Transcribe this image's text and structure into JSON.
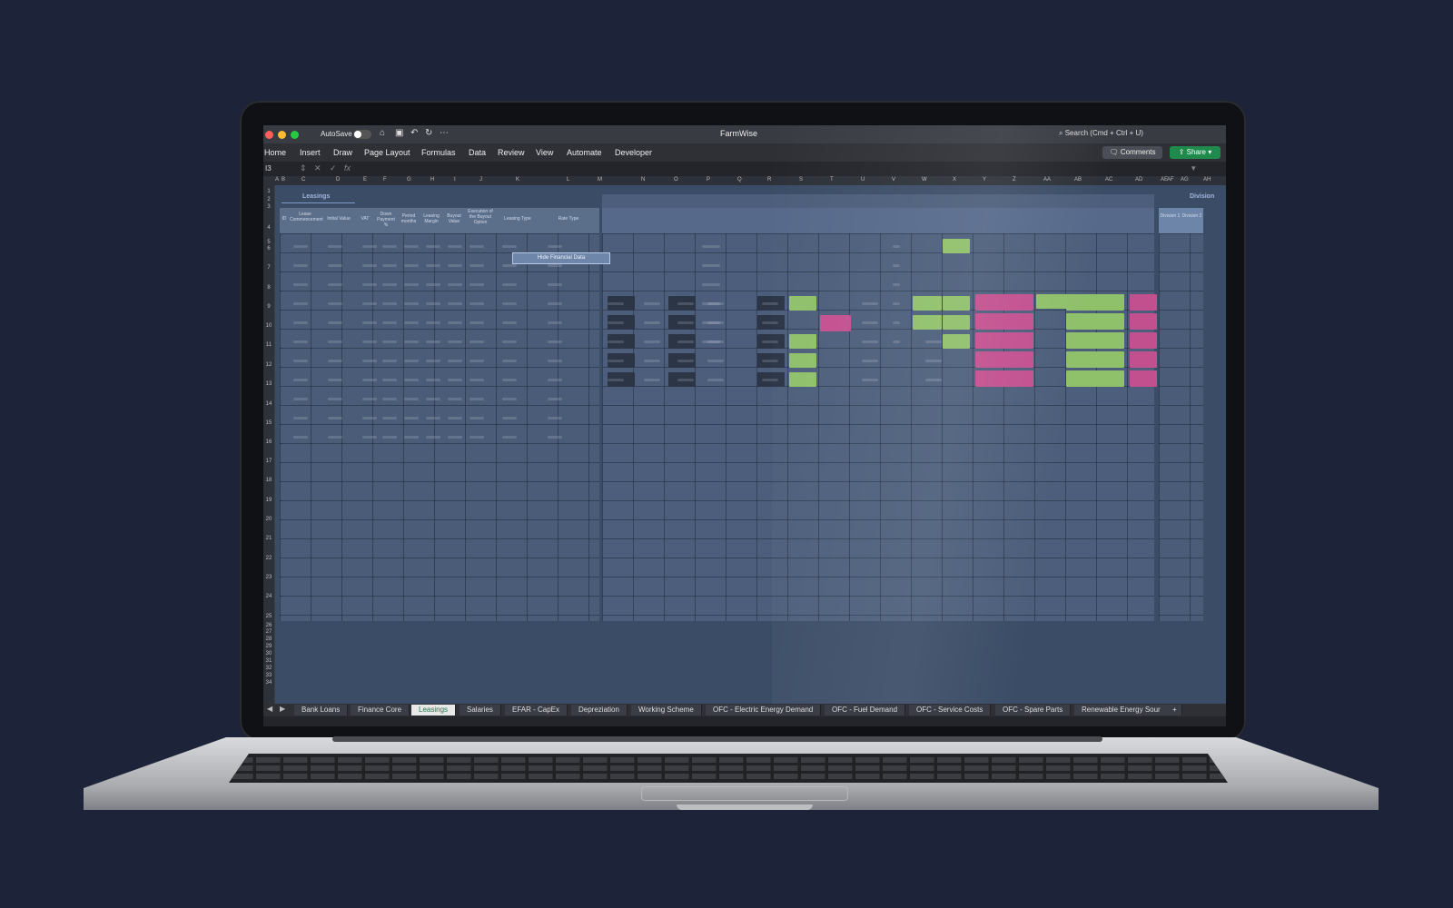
{
  "window": {
    "title": "FarmWise",
    "autosave_label": "AutoSave",
    "search_label": "Search (Cmd + Ctrl + U)"
  },
  "ribbon": {
    "menus": [
      "Home",
      "Insert",
      "Draw",
      "Page Layout",
      "Formulas",
      "Data",
      "Review",
      "View",
      "Automate",
      "Developer"
    ],
    "comments_label": "Comments",
    "share_label": "Share"
  },
  "formula_bar": {
    "name_box": "I3",
    "fx": "fx"
  },
  "columns": [
    "A",
    "B",
    "C",
    "D",
    "E",
    "F",
    "G",
    "H",
    "I",
    "J",
    "K",
    "L",
    "M",
    "N",
    "O",
    "P",
    "Q",
    "R",
    "S",
    "T",
    "U",
    "V",
    "W",
    "X",
    "Y",
    "Z",
    "AA",
    "AB",
    "AC",
    "AD",
    "AE",
    "AF",
    "AG",
    "AH"
  ],
  "rows": [
    "1",
    "2",
    "3",
    "4",
    "5",
    "6",
    "7",
    "8",
    "9",
    "10",
    "11",
    "12",
    "13",
    "14",
    "15",
    "16",
    "17",
    "18",
    "19",
    "20",
    "21",
    "22",
    "23",
    "24",
    "25",
    "26",
    "27",
    "28",
    "29",
    "30",
    "31",
    "32",
    "33",
    "34"
  ],
  "sheet": {
    "section_title": "Leasings",
    "section_title_right": "Division",
    "hide_button_label": "Hide Financial Data",
    "headers": [
      "ID",
      "Lease Commencement",
      "Initial Value",
      "VAT",
      "Down Payment %",
      "Period months",
      "Leasing Margin",
      "Buyout Value",
      "Execution of the Buyout Option",
      "Leasing Type",
      "Rate Type"
    ],
    "division_headers": [
      "Division 1",
      "Division 2"
    ]
  },
  "tabs": {
    "items": [
      "Bank Loans",
      "Finance Core",
      "Leasings",
      "Salaries",
      "EFAR - CapEx",
      "Depreziation",
      "Working Scheme",
      "OFC - Electric Energy Demand",
      "OFC - Fuel Demand",
      "OFC - Service Costs",
      "OFC - Spare Parts",
      "Renewable Energy Sour"
    ],
    "active": "Leasings",
    "add_label": "+"
  },
  "colors": {
    "background": "#1d2338",
    "accent_green": "#1e8a4b",
    "cell_green": "#8fc06a",
    "cell_pink": "#c2508f",
    "sheet_fill": "#3b4c66"
  }
}
